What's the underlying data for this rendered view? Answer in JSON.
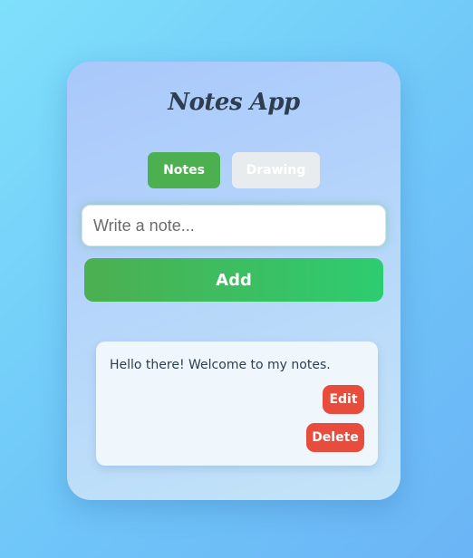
{
  "app": {
    "title": "Notes App"
  },
  "modes": {
    "notes_label": "Notes",
    "drawing_label": "Drawing",
    "active": "Notes"
  },
  "input": {
    "placeholder": "Write a note...",
    "value": ""
  },
  "actions": {
    "add_label": "Add"
  },
  "notes": [
    {
      "text": "Hello there! Welcome to my notes.",
      "edit_label": "Edit",
      "delete_label": "Delete"
    }
  ],
  "colors": {
    "primary": "#4caf50",
    "danger": "#e74c3c",
    "inactive": "#e9ecef",
    "title": "#2c3e50"
  }
}
